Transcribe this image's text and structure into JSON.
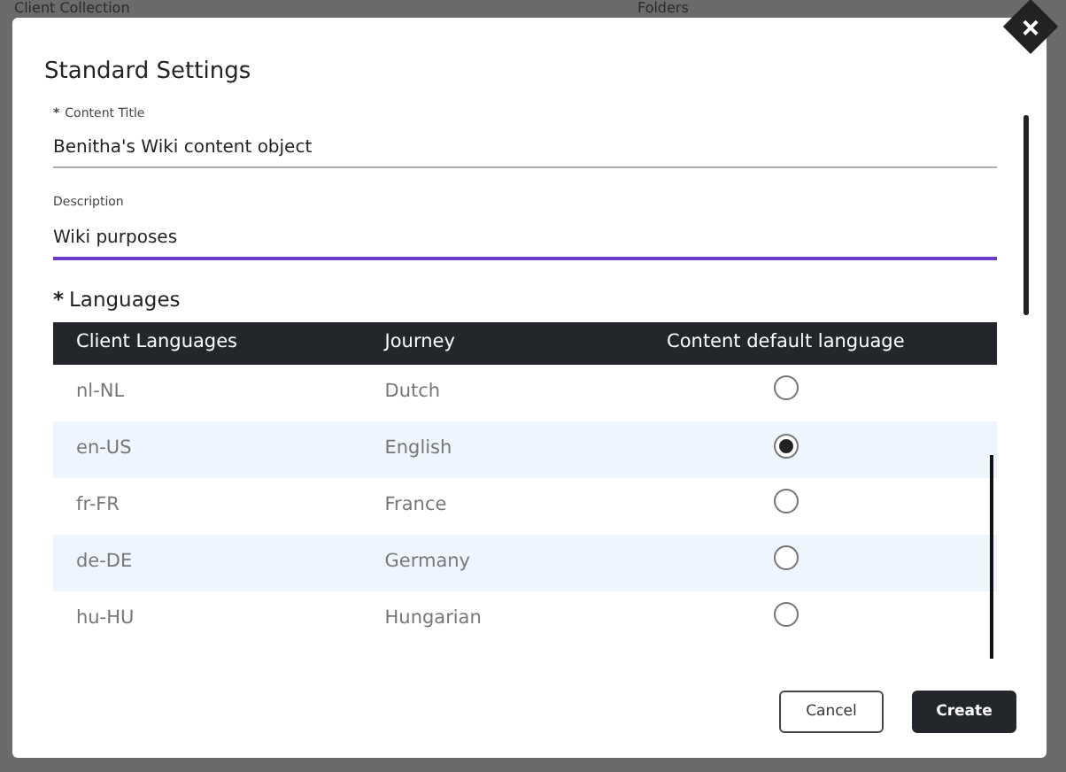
{
  "required_mark": "*",
  "background": {
    "texts": [
      "Client Collection",
      "Folders"
    ]
  },
  "modal": {
    "title": "Standard Settings",
    "fields": [
      {
        "label": "Content Title",
        "required": true,
        "value": "Benitha's Wiki content object",
        "focused": false
      },
      {
        "label": "Description",
        "required": false,
        "value": "Wiki purposes",
        "focused": true
      }
    ],
    "languages": {
      "label": "Languages",
      "required": true,
      "columns": [
        "Client Languages",
        "Journey",
        "Content default language"
      ],
      "rows": [
        {
          "code": "nl-NL",
          "journey": "Dutch",
          "selected": false
        },
        {
          "code": "en-US",
          "journey": "English",
          "selected": true
        },
        {
          "code": "fr-FR",
          "journey": "France",
          "selected": false
        },
        {
          "code": "de-DE",
          "journey": "Germany",
          "selected": false
        },
        {
          "code": "hu-HU",
          "journey": "Hungarian",
          "selected": false
        }
      ]
    },
    "buttons": [
      {
        "label": "Cancel",
        "kind": "secondary"
      },
      {
        "label": "Create",
        "kind": "primary"
      }
    ]
  }
}
